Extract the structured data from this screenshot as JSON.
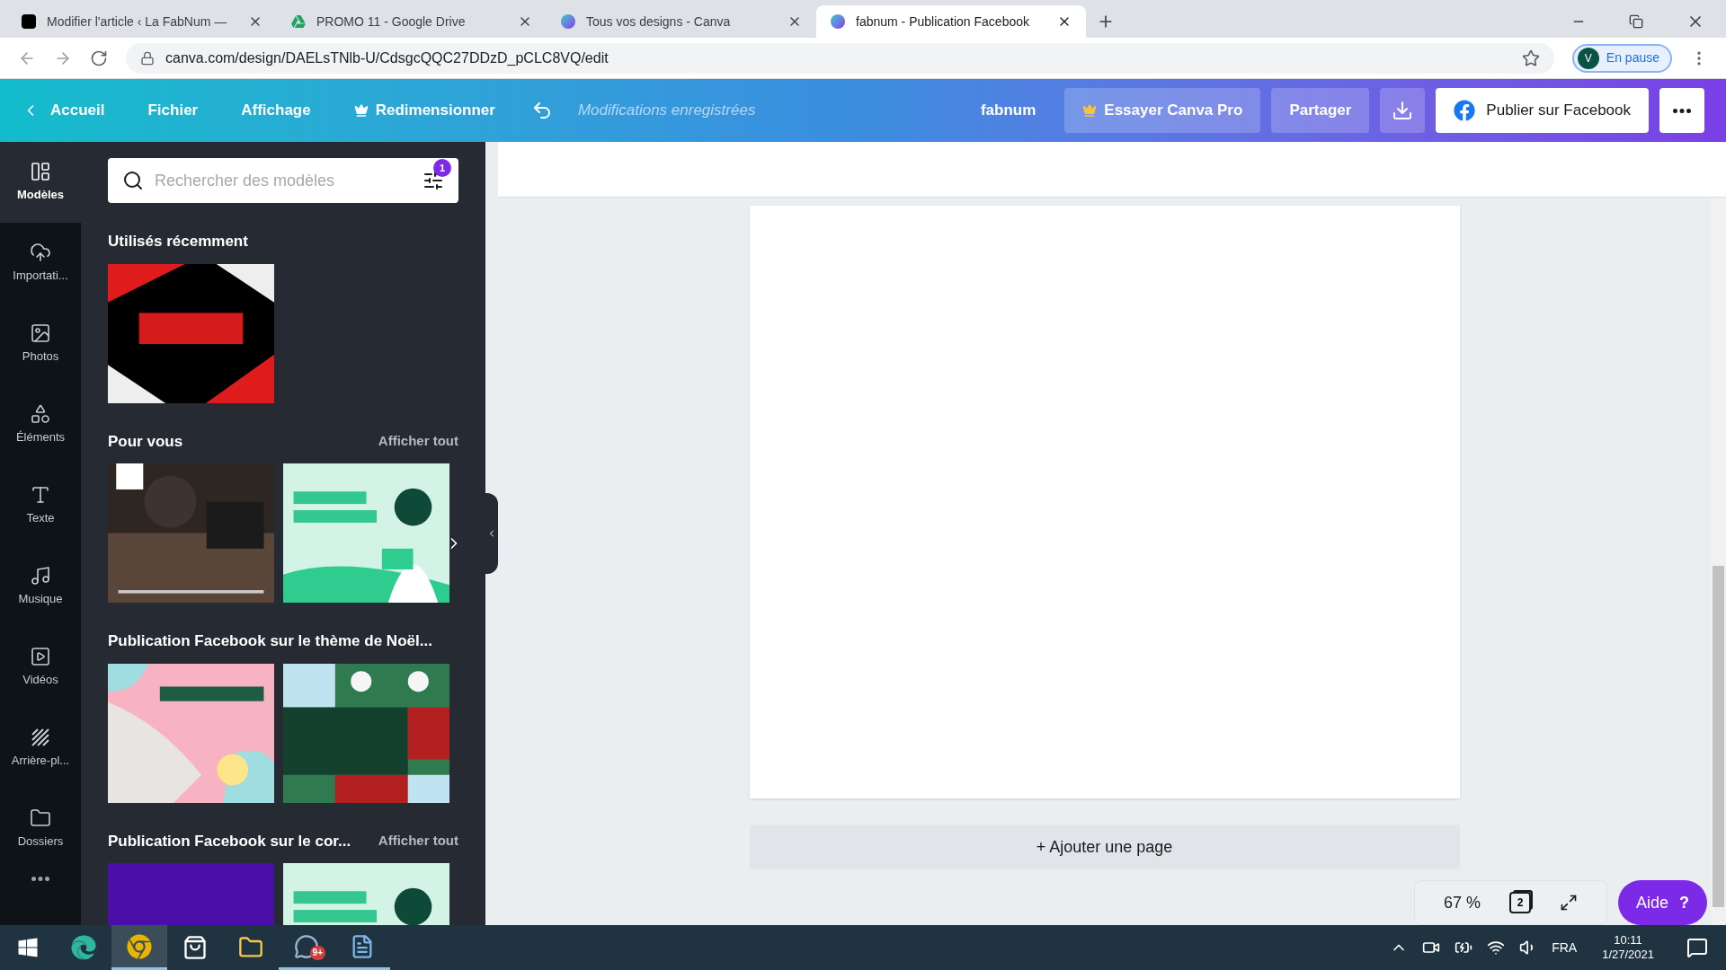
{
  "browser": {
    "tabs": [
      {
        "title": "Modifier l'article ‹ La FabNum —",
        "kind": "site",
        "selected": false
      },
      {
        "title": "PROMO 11 - Google Drive",
        "kind": "drive",
        "selected": false
      },
      {
        "title": "Tous vos designs - Canva",
        "kind": "canva",
        "selected": false
      },
      {
        "title": "fabnum - Publication Facebook",
        "kind": "canva",
        "selected": true
      }
    ],
    "url": "canva.com/design/DAELsTNlb-U/CdsgcQQC27DDzD_pCLC8VQ/edit",
    "profile_initial": "V",
    "profile_status": "En pause"
  },
  "header": {
    "back": "Accueil",
    "menu": [
      "Fichier",
      "Affichage"
    ],
    "resize": "Redimensionner",
    "status": "Modifications enregistrées",
    "team": "fabnum",
    "try_pro": "Essayer Canva Pro",
    "share": "Partager",
    "publish": "Publier sur Facebook"
  },
  "sidebar": {
    "items": [
      {
        "label": "Modèles",
        "kind": "templates",
        "selected": true
      },
      {
        "label": "Importati...",
        "kind": "upload",
        "selected": false
      },
      {
        "label": "Photos",
        "kind": "photos",
        "selected": false
      },
      {
        "label": "Éléments",
        "kind": "elements",
        "selected": false
      },
      {
        "label": "Texte",
        "kind": "text",
        "selected": false
      },
      {
        "label": "Musique",
        "kind": "music",
        "selected": false
      },
      {
        "label": "Vidéos",
        "kind": "videos",
        "selected": false
      },
      {
        "label": "Arrière-pl...",
        "kind": "background",
        "selected": false
      },
      {
        "label": "Dossiers",
        "kind": "folders",
        "selected": false
      }
    ]
  },
  "panel": {
    "search": {
      "placeholder": "Rechercher des modèles",
      "filter_count": "1"
    },
    "sections": [
      {
        "title": "Utilisés récemment"
      },
      {
        "title": "Pour vous",
        "show_all": "Afficher tout"
      },
      {
        "title": "Publication Facebook sur le thème de Noël..."
      },
      {
        "title": "Publication Facebook sur le cor...",
        "show_all": "Afficher tout"
      }
    ]
  },
  "canvas": {
    "add_page": "+ Ajouter une page",
    "zoom": "67 %",
    "page_count": "2",
    "help": "Aide",
    "help_mark": "?"
  },
  "taskbar": {
    "apps": [
      {
        "kind": "edge",
        "selected": false,
        "open": false
      },
      {
        "kind": "chrome",
        "selected": true,
        "open": true
      },
      {
        "kind": "store",
        "selected": false,
        "open": false
      },
      {
        "kind": "explorer",
        "selected": false,
        "open": false
      },
      {
        "kind": "chat",
        "selected": false,
        "open": true,
        "badge": "9+"
      },
      {
        "kind": "writer",
        "selected": false,
        "open": true
      }
    ],
    "language": "FRA",
    "time": "10:11",
    "date": "1/27/2021"
  }
}
